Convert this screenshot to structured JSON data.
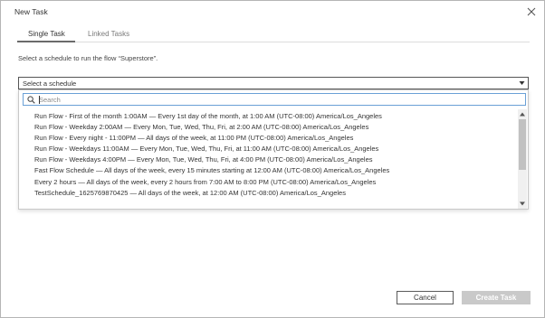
{
  "dialog": {
    "title": "New Task"
  },
  "tabs": [
    {
      "label": "Single Task",
      "active": true
    },
    {
      "label": "Linked Tasks",
      "active": false
    }
  ],
  "instruction": "Select a schedule to run the flow “Superstore”.",
  "select": {
    "value": "Select a schedule"
  },
  "dropdown": {
    "search_placeholder": "Search",
    "search_value": "",
    "options": [
      "Run Flow - First of the month 1:00AM — Every 1st day of the month, at 1:00 AM (UTC-08:00) America/Los_Angeles",
      "Run Flow - Weekday 2:00AM — Every Mon, Tue, Wed, Thu, Fri, at 2:00 AM (UTC-08:00) America/Los_Angeles",
      "Run Flow - Every night - 11:00PM — All days of the week, at 11:00 PM (UTC-08:00) America/Los_Angeles",
      "Run Flow - Weekdays 11:00AM — Every Mon, Tue, Wed, Thu, Fri, at 11:00 AM (UTC-08:00) America/Los_Angeles",
      "Run Flow - Weekdays 4:00PM — Every Mon, Tue, Wed, Thu, Fri, at 4:00 PM (UTC-08:00) America/Los_Angeles",
      "Fast Flow Schedule — All days of the week, every 15 minutes starting at 12:00 AM (UTC-08:00) America/Los_Angeles",
      "Every 2 hours — All days of the week, every 2 hours from 7:00 AM to 8:00 PM (UTC-08:00) America/Los_Angeles",
      "TestSchedule_1625769870425 — All days of the week, at 12:00 AM (UTC-08:00) America/Los_Angeles"
    ]
  },
  "footer": {
    "cancel_label": "Cancel",
    "create_label": "Create Task",
    "create_enabled": false
  },
  "colors": {
    "border": "#b5b5b5",
    "search_focus": "#6aa0d6",
    "disabled_button": "#c9c9c9"
  }
}
